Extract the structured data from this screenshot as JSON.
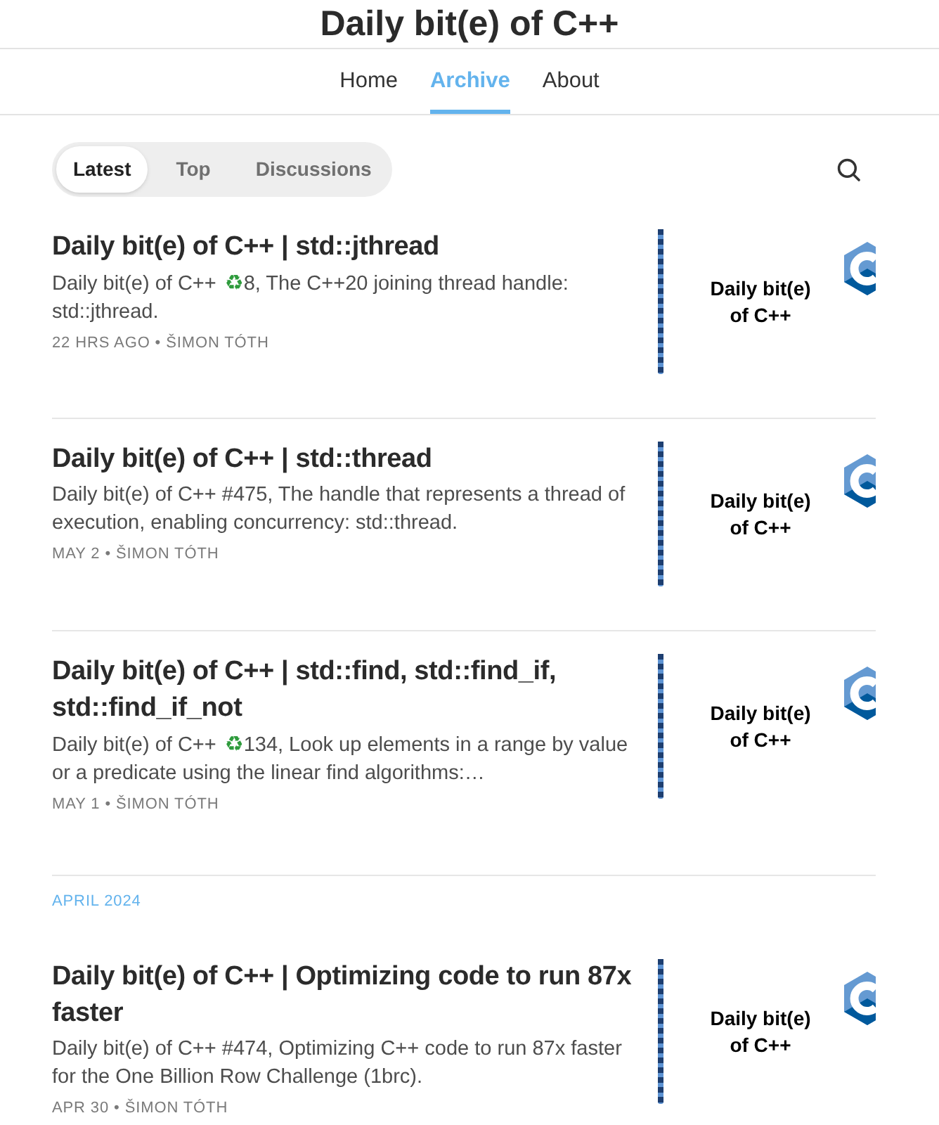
{
  "site": {
    "title": "Daily bit(e) of C++"
  },
  "nav": [
    {
      "label": "Home",
      "selected": false
    },
    {
      "label": "Archive",
      "selected": true
    },
    {
      "label": "About",
      "selected": false
    }
  ],
  "filter_tabs": [
    {
      "label": "Latest",
      "selected": true
    },
    {
      "label": "Top",
      "selected": false
    },
    {
      "label": "Discussions",
      "selected": false
    }
  ],
  "sections": [
    {
      "posts": [
        {
          "title": "Daily bit(e) of C++ | std::jthread",
          "description": [
            {
              "kind": "text",
              "text": "Daily bit(e) of C++"
            },
            {
              "kind": "emoji",
              "text": "♻"
            },
            {
              "kind": "text",
              "text": "8, The C++20 joining thread handle: std::jthread."
            }
          ],
          "meta": "22 HRS AGO • ŠIMON TÓTH",
          "thumbnail": {
            "caption": "Daily bit(e) of C++"
          }
        },
        {
          "title": "Daily bit(e) of C++ | std::thread",
          "description": [
            {
              "kind": "text",
              "text": "Daily bit(e) of C++ #475, The handle that represents a thread of execution, enabling concurrency: std::thread."
            }
          ],
          "meta": "MAY 2 • ŠIMON TÓTH",
          "thumbnail": {
            "caption": "Daily bit(e) of C++"
          }
        },
        {
          "title": "Daily bit(e) of C++ | std::find, std::find_if, std::find_if_not",
          "description": [
            {
              "kind": "text",
              "text": "Daily bit(e) of C++"
            },
            {
              "kind": "emoji",
              "text": "♻"
            },
            {
              "kind": "text",
              "text": "134, Look up elements in a range by value or a predicate using the linear find algorithms:…"
            }
          ],
          "meta": "MAY 1 • ŠIMON TÓTH",
          "thumbnail": {
            "caption": "Daily bit(e) of C++"
          }
        }
      ]
    },
    {
      "heading": "APRIL 2024",
      "posts": [
        {
          "title": "Daily bit(e) of C++ | Optimizing code to run 87x faster",
          "description": [
            {
              "kind": "text",
              "text": "Daily bit(e) of C++ #474, Optimizing C++ code to run 87x faster for the One Billion Row Challenge (1brc)."
            }
          ],
          "meta": "APR 30 • ŠIMON TÓTH",
          "thumbnail": {
            "caption": "Daily bit(e) of C++"
          }
        }
      ]
    }
  ]
}
